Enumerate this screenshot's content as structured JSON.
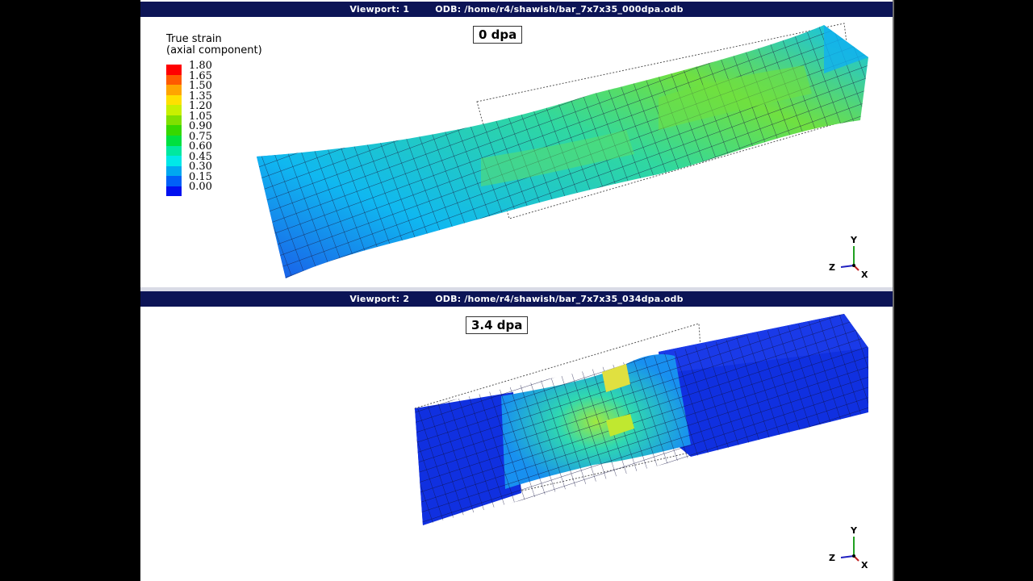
{
  "viewport1": {
    "title": "Viewport: 1",
    "odb": "ODB: /home/r4/shawish/bar_7x7x35_000dpa.odb",
    "label": "0 dpa"
  },
  "viewport2": {
    "title": "Viewport: 2",
    "odb": "ODB: /home/r4/shawish/bar_7x7x35_034dpa.odb",
    "label": "3.4 dpa"
  },
  "legend": {
    "title_line1": "True strain",
    "title_line2": "(axial component)",
    "values": [
      "1.80",
      "1.65",
      "1.50",
      "1.35",
      "1.20",
      "1.05",
      "0.90",
      "0.75",
      "0.60",
      "0.45",
      "0.30",
      "0.15",
      "0.00"
    ],
    "colors": [
      "#ff0000",
      "#ff5a00",
      "#ffa500",
      "#ffe000",
      "#c8f000",
      "#80e000",
      "#36d800",
      "#00e040",
      "#00e8a0",
      "#00e8e8",
      "#00a8f0",
      "#0060f8",
      "#0010f0"
    ]
  },
  "triad": {
    "y_label": "Y",
    "z_label": "Z",
    "x_label": "X"
  },
  "colors": {
    "titlebar": "#0c1456",
    "mesh_blue": "#1030e0",
    "mesh_cyan": "#10c8f0",
    "mesh_green": "#40e040"
  }
}
